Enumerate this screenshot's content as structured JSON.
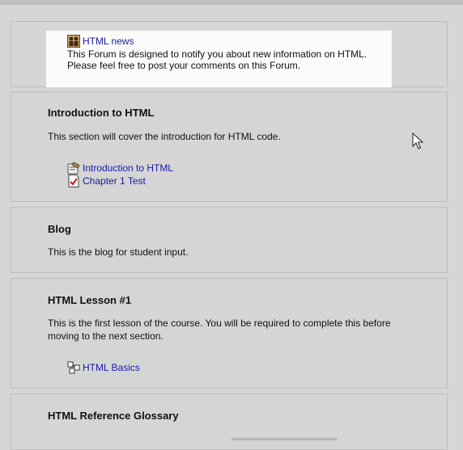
{
  "forum": {
    "link": "HTML news",
    "line1": "This Forum is designed to notify you about new information on HTML.",
    "line2": "Please feel free to post your comments on this Forum.",
    "icon": "forum-icon"
  },
  "sections": [
    {
      "title": "Introduction to HTML",
      "summary": "This section will cover the introduction for HTML code.",
      "activities": [
        {
          "label": "Introduction to HTML",
          "icon": "resource-icon"
        },
        {
          "label": "Chapter 1 Test",
          "icon": "quiz-icon"
        }
      ]
    },
    {
      "title": "Blog",
      "summary": "This is the blog for student input."
    },
    {
      "title": "HTML Lesson #1",
      "summary_line1": "This is the first lesson of the course. You will be required to complete this before",
      "summary_line2": "moving to the next section.",
      "activities": [
        {
          "label": "HTML Basics",
          "icon": "lesson-icon"
        }
      ]
    },
    {
      "title": "HTML Reference Glossary"
    }
  ]
}
